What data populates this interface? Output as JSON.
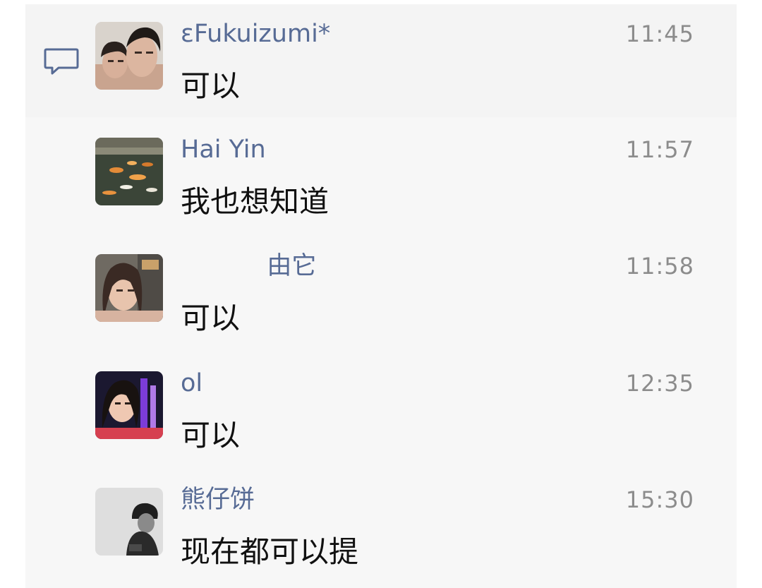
{
  "comments": [
    {
      "author": "εFukuizumi*",
      "time": "11:45",
      "text": "可以",
      "avatar": "avatar-couple-selfie",
      "show_icon": true
    },
    {
      "author": "Hai Yin",
      "time": "11:57",
      "text": "我也想知道",
      "avatar": "avatar-koi-pond",
      "show_icon": false
    },
    {
      "author": "           由它",
      "time": "11:58",
      "text": "可以",
      "avatar": "avatar-woman-selfie",
      "show_icon": false
    },
    {
      "author": "ol",
      "time": "12:35",
      "text": "可以",
      "avatar": "avatar-woman-neon",
      "show_icon": false
    },
    {
      "author": "熊仔饼",
      "time": "15:30",
      "text": "现在都可以提",
      "avatar": "avatar-man-black-white",
      "show_icon": false
    }
  ],
  "icons": {
    "comment": "comment-bubble-icon"
  },
  "colors": {
    "author": "#576b95",
    "time": "#8c8c8c",
    "text": "#111111",
    "panel_background": "#f7f7f7",
    "icon": "#576b95"
  }
}
